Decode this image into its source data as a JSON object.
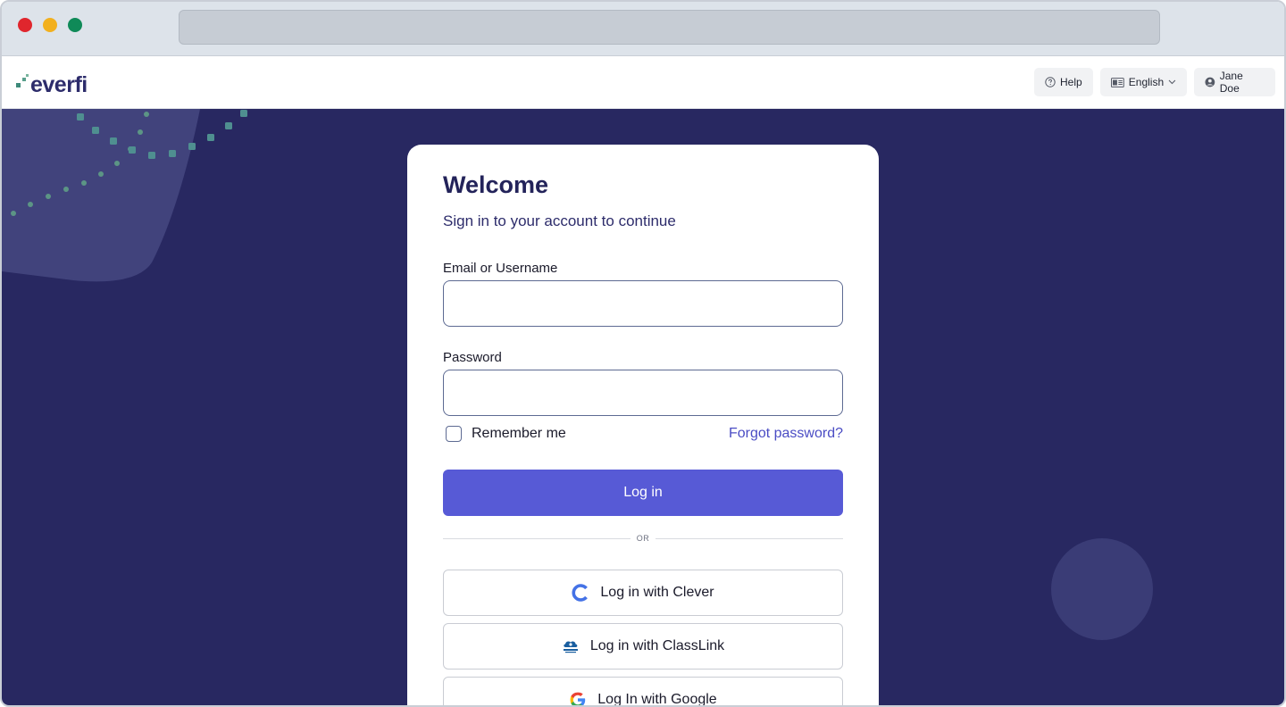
{
  "header": {
    "logo_text": "everfi",
    "help_label": "Help",
    "language_label": "English",
    "user_name": "Jane Doe"
  },
  "login": {
    "title": "Welcome",
    "subtitle": "Sign in to your account to continue",
    "email_label": "Email or Username",
    "email_value": "",
    "password_label": "Password",
    "password_value": "",
    "remember_label": "Remember me",
    "remember_checked": false,
    "forgot_label": "Forgot password?",
    "login_button": "Log in",
    "divider_text": "OR",
    "sso": [
      {
        "label": "Log in with Clever",
        "icon": "clever-icon"
      },
      {
        "label": "Log in with ClassLink",
        "icon": "classlink-icon"
      },
      {
        "label": "Log In with Google",
        "icon": "google-icon"
      }
    ]
  },
  "colors": {
    "background": "#282861",
    "primary_button": "#575ad6",
    "link": "#4a4cc4",
    "title": "#23235a",
    "accent_dots": "#5a9a8a"
  }
}
